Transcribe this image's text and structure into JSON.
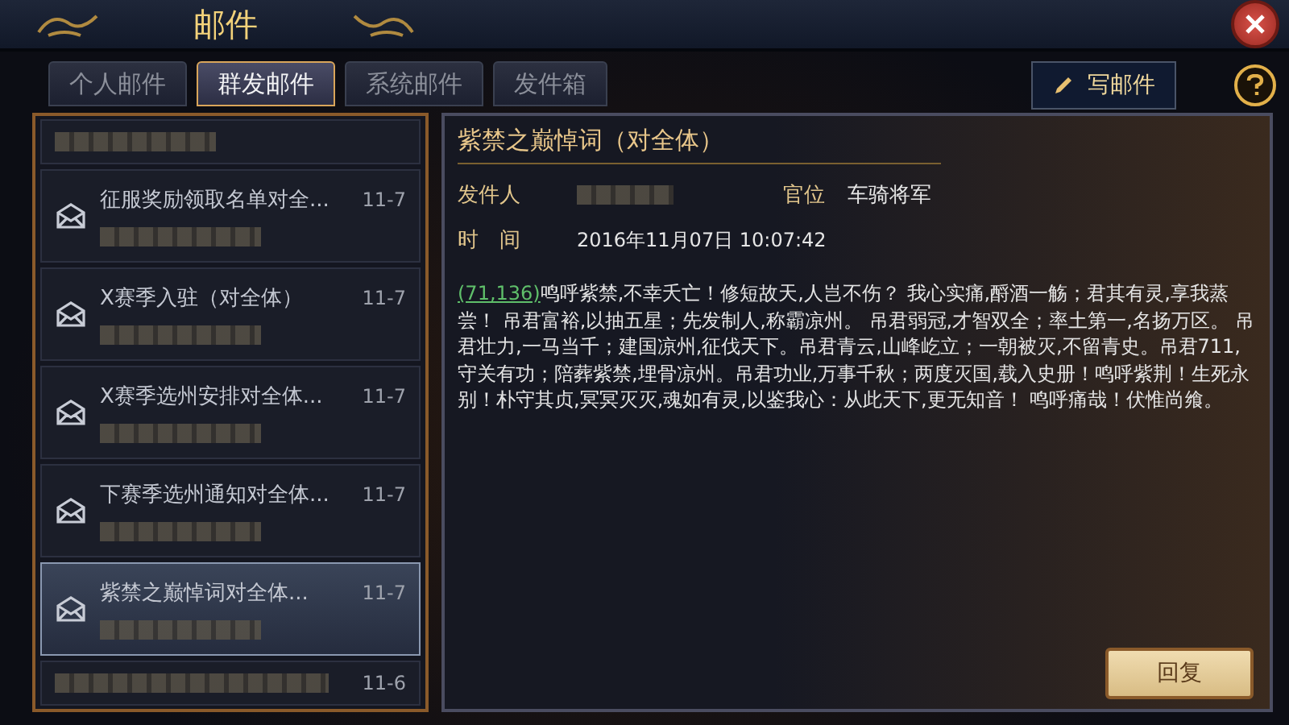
{
  "window": {
    "title": "邮件"
  },
  "tabs": [
    {
      "label": "个人邮件",
      "selected": false
    },
    {
      "label": "群发邮件",
      "selected": true
    },
    {
      "label": "系统邮件",
      "selected": false
    },
    {
      "label": "发件箱",
      "selected": false
    }
  ],
  "compose_button": {
    "label": "写邮件"
  },
  "mail_list": [
    {
      "kind": "clipped-top",
      "selected": false
    },
    {
      "kind": "full",
      "title": "征服奖励领取名单对全...",
      "date": "11-7",
      "selected": false
    },
    {
      "kind": "full",
      "title": "X赛季入驻（对全体）",
      "date": "11-7",
      "selected": false
    },
    {
      "kind": "full",
      "title": "X赛季选州安排对全体...",
      "date": "11-7",
      "selected": false
    },
    {
      "kind": "full",
      "title": "下赛季选州通知对全体...",
      "date": "11-7",
      "selected": false
    },
    {
      "kind": "full",
      "title": "紫禁之巅悼词对全体...",
      "date": "11-7",
      "selected": true
    },
    {
      "kind": "clipped-bottom",
      "date": "11-6",
      "selected": false
    }
  ],
  "message": {
    "title": "紫禁之巅悼词（对全体）",
    "sender_label": "发件人",
    "rank_label": "官位",
    "rank": "车骑将军",
    "time_label": "时　间",
    "time": "2016年11月07日 10:07:42",
    "coordinate_link": "(71,136)",
    "body": "鸣呼紫禁,不幸夭亡！修短故天,人岂不伤？ 我心实痛,酹酒一觞；君其有灵,享我蒸尝！ 吊君富裕,以抽五星；先发制人,称霸凉州。 吊君弱冠,才智双全；率土第一,名扬万区。 吊君壮力,一马当千；建国凉州,征伐天下。吊君青云,山峰屹立；一朝被灭,不留青史。吊君711,守关有功；陪葬紫禁,埋骨凉州。吊君功业,万事千秋；两度灭国,载入史册！鸣呼紫荆！生死永别！朴守其贞,冥冥灭灭,魂如有灵,以鉴我心：从此天下,更无知音！ 鸣呼痛哉！伏惟尚飨。"
  },
  "reply_button": {
    "label": "回复"
  }
}
